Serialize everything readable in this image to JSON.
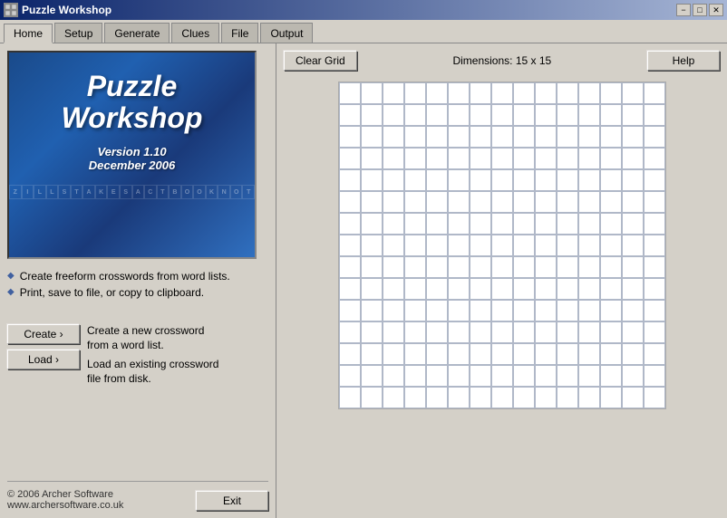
{
  "window": {
    "title": "Puzzle Workshop",
    "icon": "⊞",
    "controls": {
      "minimize": "−",
      "maximize": "□",
      "close": "✕"
    }
  },
  "tabs": [
    {
      "label": "Home",
      "active": true
    },
    {
      "label": "Setup",
      "active": false
    },
    {
      "label": "Generate",
      "active": false
    },
    {
      "label": "Clues",
      "active": false
    },
    {
      "label": "File",
      "active": false
    },
    {
      "label": "Output",
      "active": false
    }
  ],
  "toolbar": {
    "clear_grid_label": "Clear Grid",
    "dimensions_label": "Dimensions: 15 x 15",
    "help_label": "Help"
  },
  "splash": {
    "title": "Puzzle\nWorkshop",
    "version": "Version 1.10",
    "date": "December 2006"
  },
  "features": [
    "Create freeform crosswords from word lists.",
    "Print, save to file, or copy to clipboard."
  ],
  "actions": [
    {
      "button_label": "Create ›",
      "description": "Create a new crossword\nfrom a word list."
    },
    {
      "button_label": "Load ›",
      "description": "Load an existing crossword\nfile from disk."
    }
  ],
  "footer": {
    "copyright": "© 2006 Archer Software",
    "website": "www.archersoftware.co.uk",
    "exit_label": "Exit"
  },
  "grid": {
    "rows": 15,
    "cols": 15,
    "cell_size": 24
  }
}
